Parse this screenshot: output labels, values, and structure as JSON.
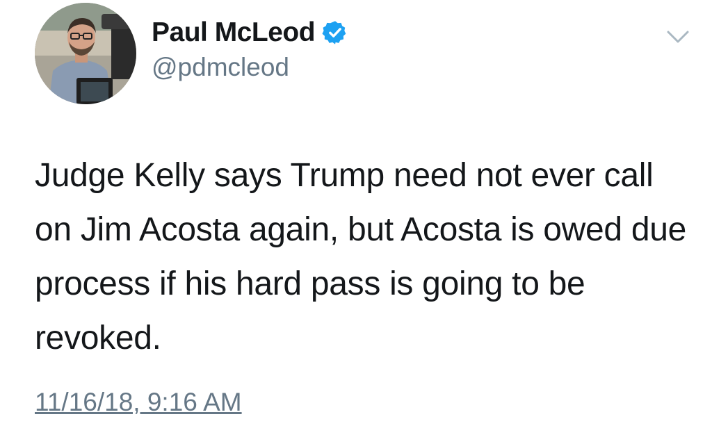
{
  "tweet": {
    "author": {
      "display_name": "Paul McLeod",
      "handle": "@pdmcleod",
      "verified": true,
      "avatar_icon": "avatar-photo"
    },
    "text": "Judge Kelly says Trump need not ever call on Jim Acosta again, but Acosta is owed due process if his hard pass is going to be revoked.",
    "timestamp": "11/16/18, 9:16 AM",
    "menu_icon": "chevron-down-icon"
  },
  "colors": {
    "verified_blue": "#1da1f2",
    "secondary_text": "#657786",
    "primary_text": "#14171a",
    "caret": "#aab8c2"
  }
}
